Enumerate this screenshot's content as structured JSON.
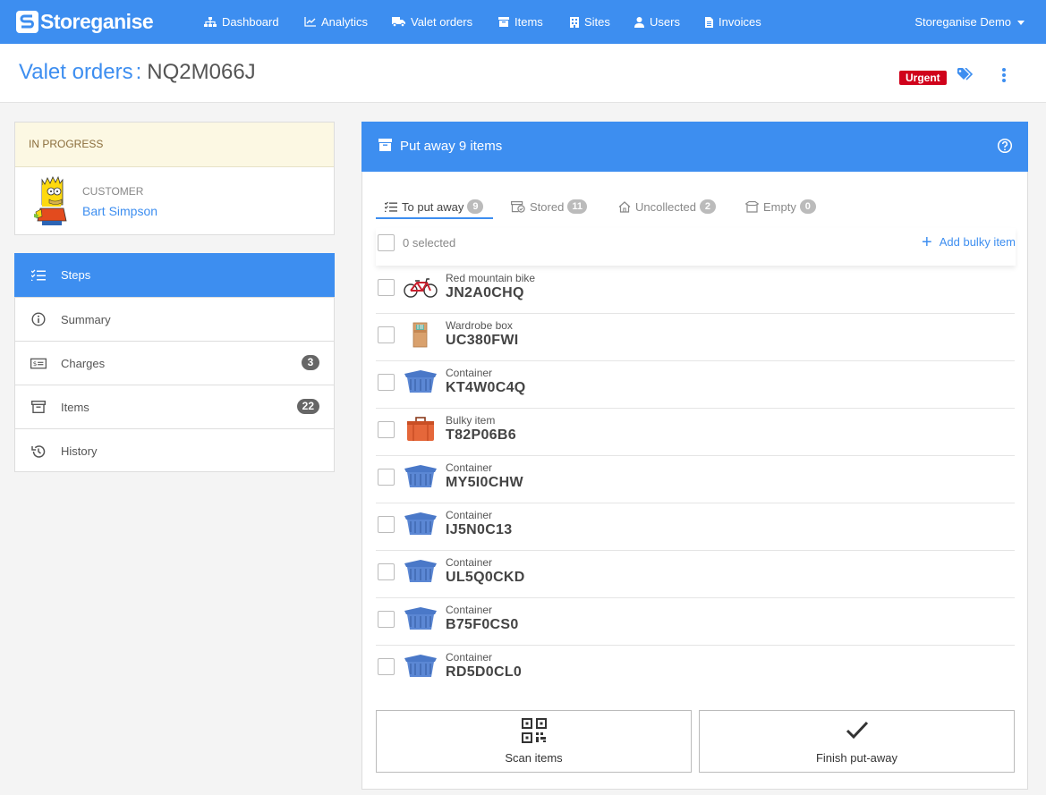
{
  "brand": {
    "name": "Storeganise",
    "accent": "#3d8ef0",
    "urgent_color": "#d0021b"
  },
  "nav": {
    "items": [
      {
        "label": "Dashboard",
        "icon": "sitemap-icon"
      },
      {
        "label": "Analytics",
        "icon": "line-chart-icon"
      },
      {
        "label": "Valet orders",
        "icon": "truck-icon"
      },
      {
        "label": "Items",
        "icon": "box-icon"
      },
      {
        "label": "Sites",
        "icon": "building-icon"
      },
      {
        "label": "Users",
        "icon": "user-icon"
      },
      {
        "label": "Invoices",
        "icon": "file-icon"
      }
    ],
    "account": "Storeganise Demo"
  },
  "header": {
    "breadcrumb": "Valet orders",
    "separator": ":",
    "order_code": "NQ2M066J",
    "urgent_badge": "Urgent"
  },
  "status": {
    "label": "IN PROGRESS"
  },
  "customer": {
    "label": "CUSTOMER",
    "name": "Bart Simpson"
  },
  "menu": [
    {
      "label": "Steps",
      "icon": "checklist-icon",
      "badge": ""
    },
    {
      "label": "Summary",
      "icon": "info-icon",
      "badge": ""
    },
    {
      "label": "Charges",
      "icon": "money-icon",
      "badge": "3"
    },
    {
      "label": "Items",
      "icon": "archive-icon",
      "badge": "22"
    },
    {
      "label": "History",
      "icon": "history-icon",
      "badge": ""
    }
  ],
  "panel": {
    "title": "Put away 9 items",
    "tabs": [
      {
        "label": "To put away",
        "count": "9",
        "icon": "checklist-icon"
      },
      {
        "label": "Stored",
        "count": "11",
        "icon": "stored-box-icon"
      },
      {
        "label": "Uncollected",
        "count": "2",
        "icon": "home-icon"
      },
      {
        "label": "Empty",
        "count": "0",
        "icon": "open-box-icon"
      }
    ],
    "selected": "0 selected",
    "add_bulky": "Add bulky item",
    "items": [
      {
        "type": "Red mountain bike",
        "code": "JN2A0CHQ",
        "thumb": "bike"
      },
      {
        "type": "Wardrobe box",
        "code": "UC380FWI",
        "thumb": "wardrobe"
      },
      {
        "type": "Container",
        "code": "KT4W0C4Q",
        "thumb": "container"
      },
      {
        "type": "Bulky item",
        "code": "T82P06B6",
        "thumb": "suitcase"
      },
      {
        "type": "Container",
        "code": "MY5I0CHW",
        "thumb": "container"
      },
      {
        "type": "Container",
        "code": "IJ5N0C13",
        "thumb": "container"
      },
      {
        "type": "Container",
        "code": "UL5Q0CKD",
        "thumb": "container"
      },
      {
        "type": "Container",
        "code": "B75F0CS0",
        "thumb": "container"
      },
      {
        "type": "Container",
        "code": "RD5D0CL0",
        "thumb": "container"
      }
    ],
    "scan_label": "Scan items",
    "finish_label": "Finish put-away"
  }
}
